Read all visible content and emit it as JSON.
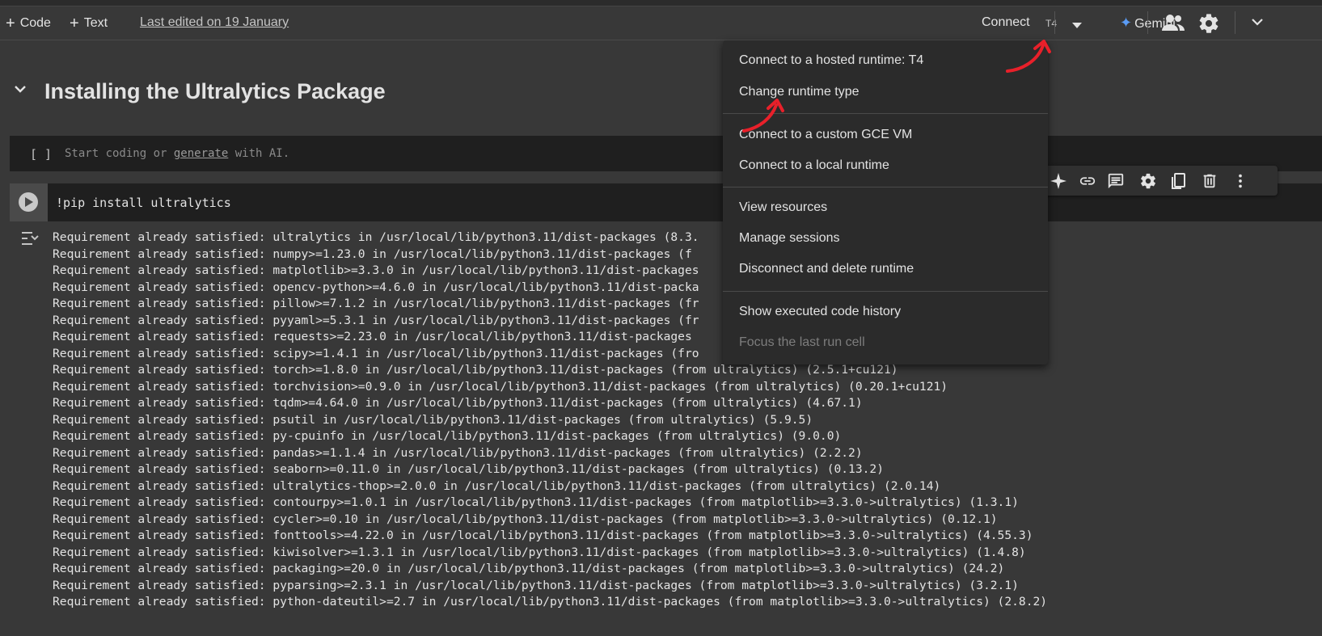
{
  "toolbar": {
    "code_label": "Code",
    "text_label": "Text",
    "last_edited": "Last edited on 19 January",
    "connect_label": "Connect",
    "runtime_badge": "T4",
    "gemini_label": "Gemini"
  },
  "section": {
    "title": "Installing the Ultralytics Package"
  },
  "empty_cell": {
    "brackets": "[ ]",
    "placeholder_prefix": "Start coding or ",
    "placeholder_link": "generate",
    "placeholder_suffix": " with AI."
  },
  "code_cell": {
    "source": "!pip install ultralytics"
  },
  "output_lines": [
    "Requirement already satisfied: ultralytics in /usr/local/lib/python3.11/dist-packages (8.3.",
    "Requirement already satisfied: numpy>=1.23.0 in /usr/local/lib/python3.11/dist-packages (f",
    "Requirement already satisfied: matplotlib>=3.3.0 in /usr/local/lib/python3.11/dist-packages",
    "Requirement already satisfied: opencv-python>=4.6.0 in /usr/local/lib/python3.11/dist-packa",
    "Requirement already satisfied: pillow>=7.1.2 in /usr/local/lib/python3.11/dist-packages (fr",
    "Requirement already satisfied: pyyaml>=5.3.1 in /usr/local/lib/python3.11/dist-packages (fr",
    "Requirement already satisfied: requests>=2.23.0 in /usr/local/lib/python3.11/dist-packages",
    "Requirement already satisfied: scipy>=1.4.1 in /usr/local/lib/python3.11/dist-packages (fro",
    "Requirement already satisfied: torch>=1.8.0 in /usr/local/lib/python3.11/dist-packages (from ultralytics) (2.5.1+cu121)",
    "Requirement already satisfied: torchvision>=0.9.0 in /usr/local/lib/python3.11/dist-packages (from ultralytics) (0.20.1+cu121)",
    "Requirement already satisfied: tqdm>=4.64.0 in /usr/local/lib/python3.11/dist-packages (from ultralytics) (4.67.1)",
    "Requirement already satisfied: psutil in /usr/local/lib/python3.11/dist-packages (from ultralytics) (5.9.5)",
    "Requirement already satisfied: py-cpuinfo in /usr/local/lib/python3.11/dist-packages (from ultralytics) (9.0.0)",
    "Requirement already satisfied: pandas>=1.1.4 in /usr/local/lib/python3.11/dist-packages (from ultralytics) (2.2.2)",
    "Requirement already satisfied: seaborn>=0.11.0 in /usr/local/lib/python3.11/dist-packages (from ultralytics) (0.13.2)",
    "Requirement already satisfied: ultralytics-thop>=2.0.0 in /usr/local/lib/python3.11/dist-packages (from ultralytics) (2.0.14)",
    "Requirement already satisfied: contourpy>=1.0.1 in /usr/local/lib/python3.11/dist-packages (from matplotlib>=3.3.0->ultralytics) (1.3.1)",
    "Requirement already satisfied: cycler>=0.10 in /usr/local/lib/python3.11/dist-packages (from matplotlib>=3.3.0->ultralytics) (0.12.1)",
    "Requirement already satisfied: fonttools>=4.22.0 in /usr/local/lib/python3.11/dist-packages (from matplotlib>=3.3.0->ultralytics) (4.55.3)",
    "Requirement already satisfied: kiwisolver>=1.3.1 in /usr/local/lib/python3.11/dist-packages (from matplotlib>=3.3.0->ultralytics) (1.4.8)",
    "Requirement already satisfied: packaging>=20.0 in /usr/local/lib/python3.11/dist-packages (from matplotlib>=3.3.0->ultralytics) (24.2)",
    "Requirement already satisfied: pyparsing>=2.3.1 in /usr/local/lib/python3.11/dist-packages (from matplotlib>=3.3.0->ultralytics) (3.2.1)",
    "Requirement already satisfied: python-dateutil>=2.7 in /usr/local/lib/python3.11/dist-packages (from matplotlib>=3.3.0->ultralytics) (2.8.2)"
  ],
  "runtime_menu": {
    "items": [
      "Connect to a hosted runtime: T4",
      "Change runtime type",
      "Connect to a custom GCE VM",
      "Connect to a local runtime",
      "View resources",
      "Manage sessions",
      "Disconnect and delete runtime",
      "Show executed code history",
      "Focus the last run cell"
    ]
  },
  "colors": {
    "background": "#383838",
    "cell_background": "#1f1f1f",
    "menu_background": "#2b2b2b",
    "annotation_arrow": "#e8202a",
    "gemini_accent": "#5b9cf6"
  },
  "icons": [
    "plus-icon",
    "chevron-down-icon",
    "gemini-star-icon",
    "people-icon",
    "gear-icon",
    "play-icon",
    "output-toggle-icon",
    "sparkle-icon",
    "link-icon",
    "comment-icon",
    "mirror-cell-icon",
    "delete-icon",
    "more-vert-icon"
  ]
}
